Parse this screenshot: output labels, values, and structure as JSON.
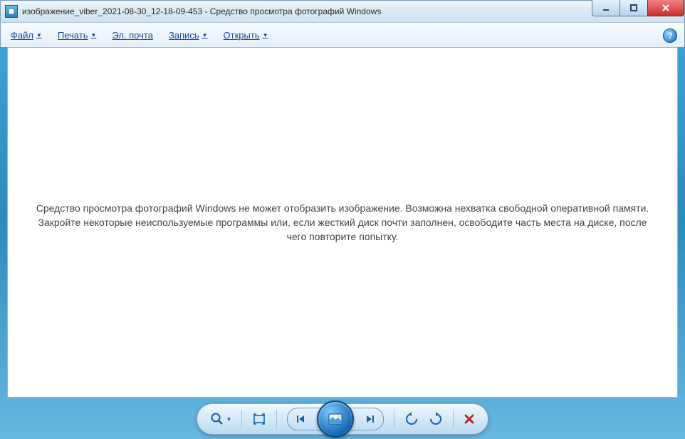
{
  "titlebar": {
    "title": "изображение_viber_2021-08-30_12-18-09-453 - Средство просмотра фотографий Windows"
  },
  "menubar": {
    "file": "Файл",
    "print": "Печать",
    "email": "Эл. почта",
    "burn": "Запись",
    "open": "Открыть",
    "help": "?"
  },
  "content": {
    "error_message": "Средство просмотра фотографий Windows не может отобразить изображение. Возможна нехватка свободной оперативной памяти. Закройте некоторые неиспользуемые программы или, если жесткий диск почти заполнен, освободите часть места на диске, после чего повторите попытку."
  }
}
